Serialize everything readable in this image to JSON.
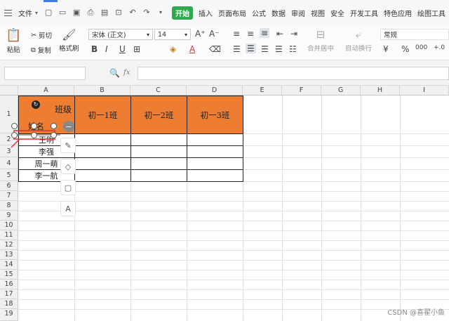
{
  "menubar": {
    "file_label": "文件",
    "tabs": [
      "开始",
      "插入",
      "页面布局",
      "公式",
      "数据",
      "审阅",
      "视图",
      "安全",
      "开发工具",
      "特色应用",
      "绘图工具"
    ]
  },
  "toolbar": {
    "paste": "粘贴",
    "cut": "剪切",
    "copy": "复制",
    "format_painter": "格式刷",
    "font_name": "宋体 (正文)",
    "font_size": "14",
    "merge_center": "合并居中",
    "wrap_text": "自动换行",
    "number_format": "常规"
  },
  "formula_bar": {
    "fx": "fx",
    "value": ""
  },
  "sheet": {
    "columns": [
      "A",
      "B",
      "C",
      "D",
      "E",
      "F",
      "G",
      "H",
      "I"
    ],
    "rows": [
      "1",
      "2",
      "3",
      "4",
      "5",
      "6",
      "7",
      "8",
      "9",
      "10",
      "11",
      "12",
      "13",
      "14",
      "15",
      "16",
      "17",
      "18",
      "19"
    ],
    "a1_top": "班级",
    "a1_bottom": "姓名",
    "headers": [
      "初一1班",
      "初一2班",
      "初一3班"
    ],
    "names": [
      "王明",
      "李强",
      "周一萌",
      "李一航"
    ]
  },
  "watermark": "CSDN @喜翟小鱼",
  "colors": {
    "header_fill": "#ed7d31",
    "active_tab": "#2fa84f",
    "selection": "#d9303a"
  }
}
